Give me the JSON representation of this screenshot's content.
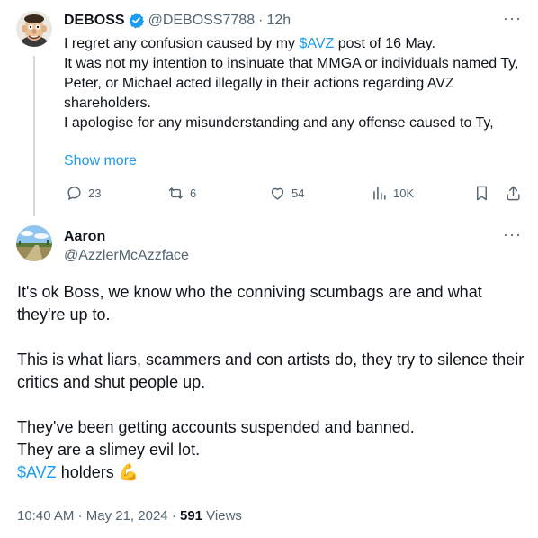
{
  "tweet1": {
    "display_name": "DEBOSS",
    "handle": "@DEBOSS7788",
    "separator": "·",
    "time": "12h",
    "text_part1": "I regret any confusion caused by my ",
    "cashtag": "$AVZ",
    "text_part2": " post of 16 May.",
    "line2": "It was not my intention to insinuate that MMGA or individuals named Ty, Peter, or Michael acted illegally in their actions regarding AVZ shareholders.",
    "line3": "I apologise for any misunderstanding and any offense caused to Ty,",
    "show_more": "Show more",
    "more_menu": "···",
    "replies": "23",
    "reposts": "6",
    "likes": "54",
    "views": "10K",
    "verified_color": "#1d9bf0"
  },
  "tweet2": {
    "display_name": "Aaron",
    "handle": "@AzzlerMcAzzface",
    "more_menu": "···",
    "para1": "It's ok Boss, we know who the conniving scumbags are and what they're up to.",
    "para2": "This is what liars, scammers and con artists do, they try to silence their critics and shut people up.",
    "para3_line1": "They've been getting accounts suspended and banned.",
    "para3_line2": "They are a slimey evil lot.",
    "cashtag": "$AVZ",
    "holders_text": " holders ",
    "emoji": "💪",
    "time": "10:40 AM",
    "dot": "·",
    "date": "May 21, 2024",
    "views_count": "591",
    "views_label": " Views"
  },
  "colors": {
    "link": "#1d9bf0",
    "secondary_text": "#536471",
    "thread_line": "#cfd9de"
  }
}
